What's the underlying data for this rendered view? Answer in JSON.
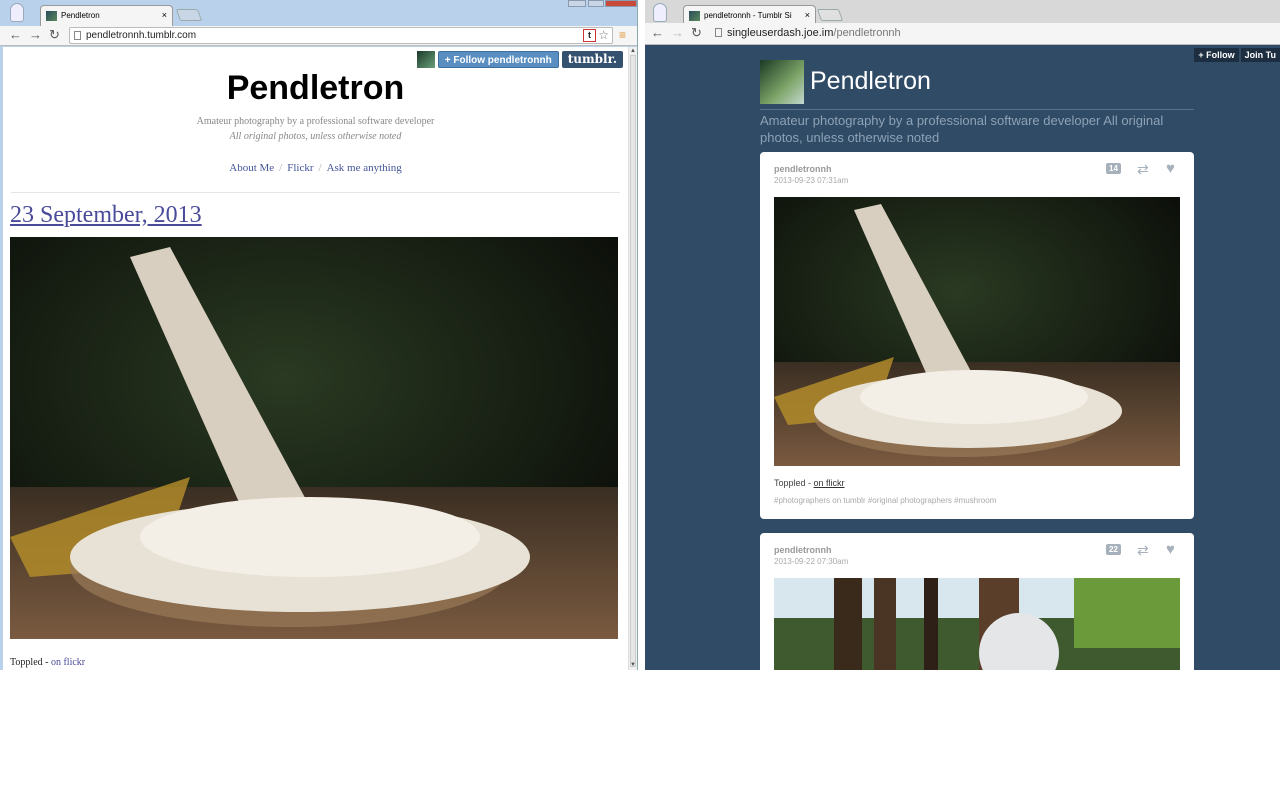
{
  "left_window": {
    "tab_title": "Pendletron",
    "tab_close": "×",
    "url": "pendletronnh.tumblr.com",
    "tumblr_controls": {
      "follow_label": "+ Follow pendletronnh",
      "logo_text": "tumblr."
    },
    "blog": {
      "title": "Pendletron",
      "description_line1": "Amateur photography by a professional software developer",
      "description_line2": "All original photos, unless otherwise noted",
      "nav_links": [
        "About Me",
        "Flickr",
        "Ask me anything"
      ],
      "separator": "/"
    },
    "post": {
      "date": "23 September, 2013",
      "caption_text": "Toppled - ",
      "caption_link": "on flickr"
    }
  },
  "right_window": {
    "tab_title": "pendletronnh - Tumblr Si",
    "tab_close": "×",
    "url_host": "singleuserdash.joe.im",
    "url_path": "/pendletronnh",
    "top_buttons": [
      "+ Follow",
      "Join Tu"
    ],
    "blog_title": "Pendletron",
    "blog_description": "Amateur photography by a professional software developer All original photos, unless otherwise noted",
    "posts": [
      {
        "username": "pendletronnh",
        "timestamp": "2013-09-23 07:31am",
        "notes": "14",
        "caption_text": "Toppled - ",
        "caption_link": "on flickr",
        "tags": "#photographers on tumblr  #original photographers  #mushroom"
      },
      {
        "username": "pendletronnh",
        "timestamp": "2013-09-22 07:30am",
        "notes": "22"
      }
    ]
  },
  "icons": [
    "back-icon",
    "forward-icon",
    "reload-icon",
    "page-icon",
    "tumblr-icon",
    "star-icon",
    "menu-icon",
    "reblog-icon",
    "heart-icon"
  ],
  "colors": {
    "dash_bg": "#2f4b66",
    "link": "#4a4a9a",
    "follow_btn": "#5a8ec0"
  }
}
